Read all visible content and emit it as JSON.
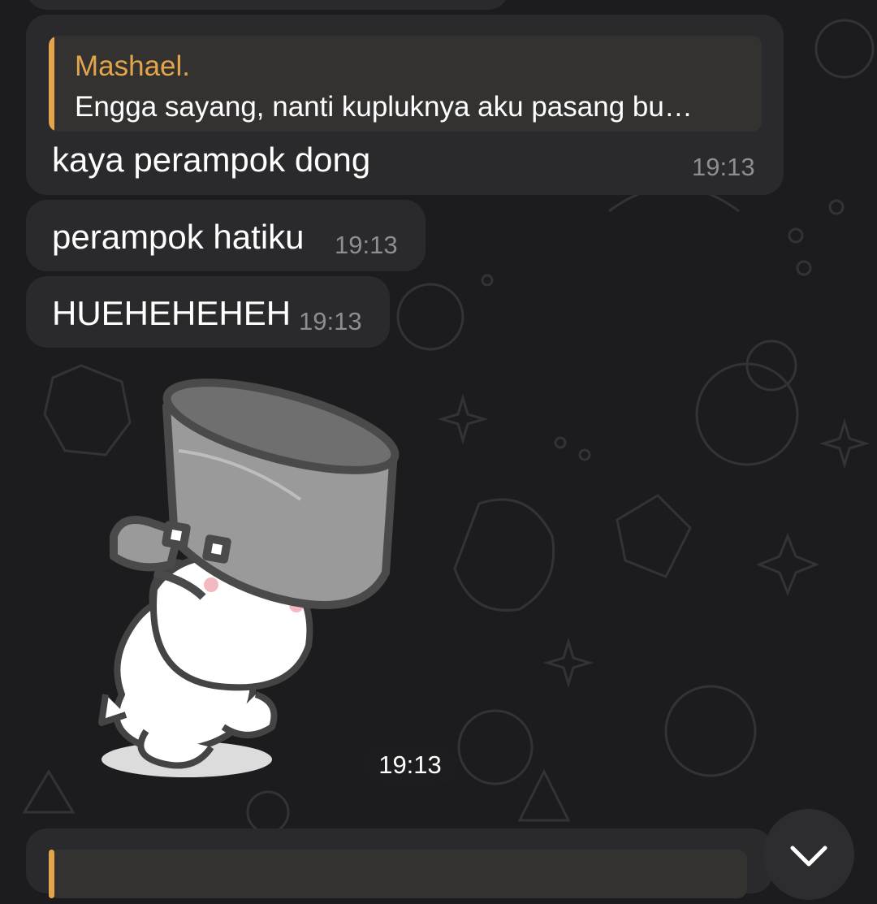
{
  "chat": {
    "messages": [
      {
        "reply_name": "Mashael.",
        "reply_text": "Engga sayang, nanti kupluknya aku pasang bu…",
        "text": "kaya perampok dong",
        "time": "19:13"
      },
      {
        "text": "perampok hatiku",
        "time": "19:13"
      },
      {
        "text": "HUEHEHEHEH",
        "time": "19:13"
      }
    ],
    "sticker": {
      "name": "bear-carrying-pot-sticker",
      "time": "19:13"
    }
  },
  "colors": {
    "background": "#1c1c1e",
    "bubble": "#2a2a2c",
    "reply_accent": "#e3a54c",
    "time_text": "#8d8d92"
  },
  "icons": {
    "scroll_down": "close-icon"
  }
}
